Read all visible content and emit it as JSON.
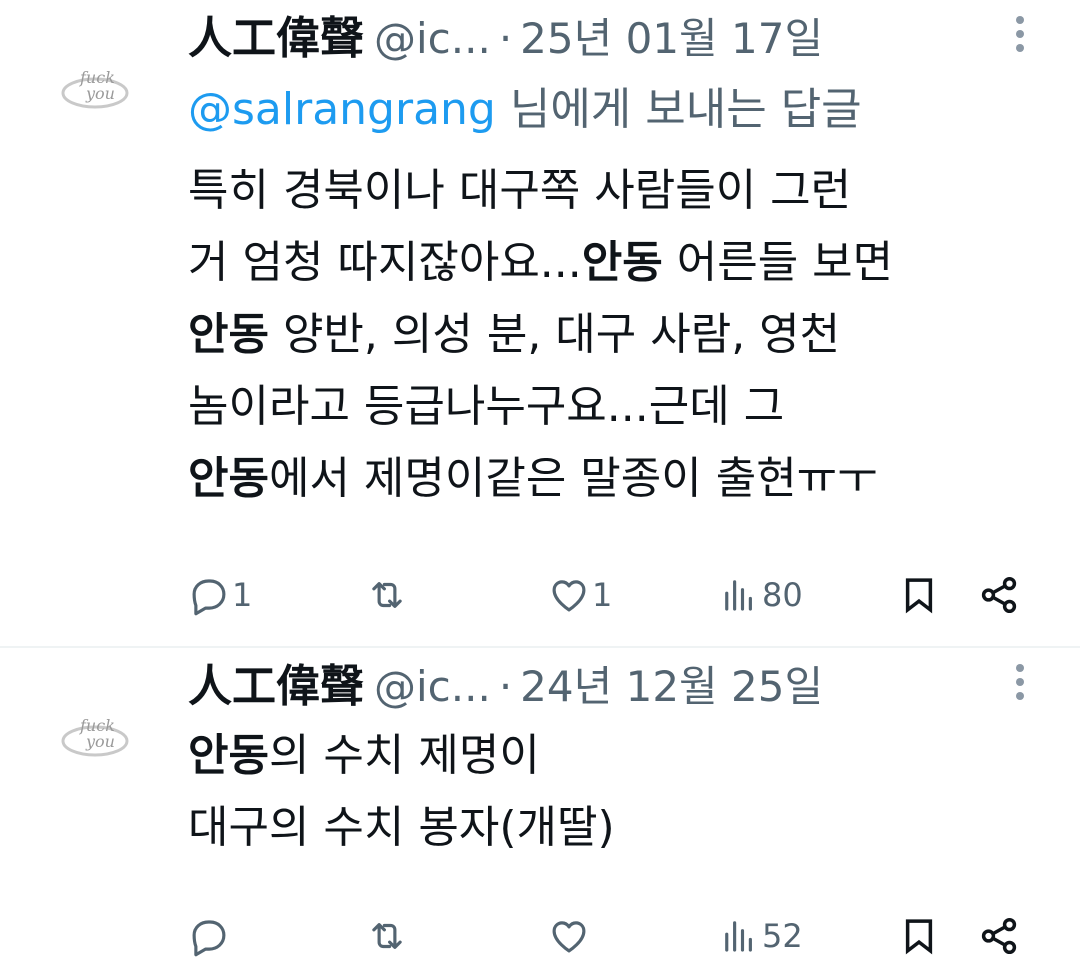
{
  "tweets": [
    {
      "display_name": "人工偉聲",
      "handle": "@ic...",
      "separator": "·",
      "date": "25년 01월 17일",
      "reply_to_mention": "@salrangrang",
      "reply_to_suffix": " 님에게 보내는 답글",
      "lines": [
        [
          {
            "text": "특히 경북이나 대구쪽 사람들이 그런",
            "bold": false
          }
        ],
        [
          {
            "text": "거 엄청 따지잖아요...",
            "bold": false
          },
          {
            "text": "안동",
            "bold": true
          },
          {
            "text": " 어른들 보면",
            "bold": false
          }
        ],
        [
          {
            "text": "안동",
            "bold": true
          },
          {
            "text": " 양반, 의성 분, 대구 사람, 영천",
            "bold": false
          }
        ],
        [
          {
            "text": "놈이라고 등급나누구요...근데 그",
            "bold": false
          }
        ],
        [
          {
            "text": "안동",
            "bold": true
          },
          {
            "text": "에서 제명이같은 말종이 출현ㅠㅜ",
            "bold": false
          }
        ]
      ],
      "actions": {
        "replies": "1",
        "retweets": "",
        "likes": "1",
        "views": "80"
      },
      "avatar_text": [
        "fuck",
        "you"
      ]
    },
    {
      "display_name": "人工偉聲",
      "handle": "@ic...",
      "separator": "·",
      "date": "24년 12월 25일",
      "lines": [
        [
          {
            "text": "안동",
            "bold": true
          },
          {
            "text": "의 수치 제명이",
            "bold": false
          }
        ],
        [
          {
            "text": "대구의 수치 봉자(개딸)",
            "bold": false
          }
        ]
      ],
      "actions": {
        "replies": "",
        "retweets": "",
        "likes": "",
        "views": "52"
      },
      "avatar_text": [
        "fuck",
        "you"
      ]
    }
  ],
  "icons": {
    "reply": "reply-icon",
    "retweet": "retweet-icon",
    "like": "heart-icon",
    "views": "views-icon",
    "bookmark": "bookmark-icon",
    "share": "share-icon",
    "more": "more-vertical-icon"
  },
  "colors": {
    "mention": "#1d9bf0",
    "secondary_text": "#536471",
    "primary_text": "#0f1419"
  }
}
